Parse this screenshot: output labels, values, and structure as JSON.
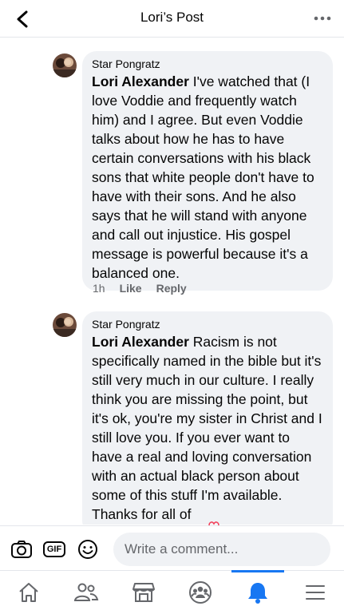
{
  "header": {
    "title": "Lori’s Post"
  },
  "comments": [
    {
      "author": "Star Pongratz",
      "mention": "Lori Alexander",
      "text": " I've watched that (I love Voddie and frequently watch him) and I agree.  But even Voddie talks about how he has to have certain conversations with his black sons that white people don't have to have with their sons.  And he also says that he will stand with anyone and call out injustice.  His gospel message is powerful because it's a balanced one.",
      "time": "1h",
      "like_label": "Like",
      "reply_label": "Reply"
    },
    {
      "author": "Star Pongratz",
      "mention": "Lori Alexander",
      "text": " Racism is not specifically named in the bible but it's still very much in our culture.  I really think you are missing the point, but it's ok, you're my sister in Christ and I still love you.  If you ever want to have a real and loving conversation with an actual black person about some of this stuff I'm available.  Thanks for all of"
    }
  ],
  "composer": {
    "placeholder": "Write a comment...",
    "gif_label": "GIF"
  },
  "nav": {
    "items": [
      "home-icon",
      "friends-icon",
      "marketplace-icon",
      "groups-icon",
      "notifications-icon",
      "menu-icon"
    ],
    "active_index": 4,
    "accent_color": "#1877f2"
  }
}
